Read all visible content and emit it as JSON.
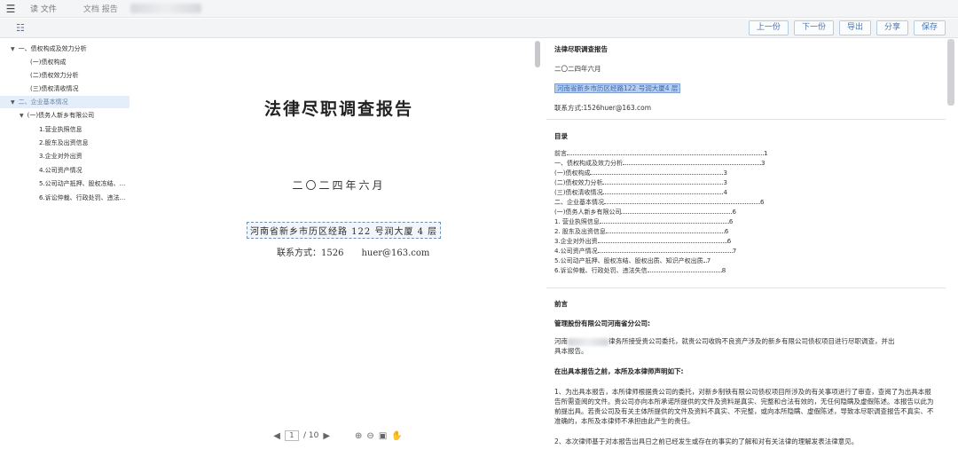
{
  "titlebar": {
    "tab1": "读 文件",
    "tab2": "文档 报告"
  },
  "toolbar": {
    "buttons": [
      "上一份",
      "下一份",
      "导出",
      "分享",
      "保存"
    ]
  },
  "sidebar": {
    "items": [
      "一、债权构成及效力分析",
      "(一)债权构成",
      "(二)债权效力分析",
      "(三)债权清收情况",
      "二、企业基本情况",
      "(一)债务人新乡有限公司",
      "1.营业执照信息",
      "2.股东及出资信息",
      "3.企业对外出资",
      "4.公司资产情况",
      "5.公司动产抵押、股权冻结、...",
      "6.诉讼仲裁、行政处罚、违法..."
    ]
  },
  "document": {
    "title": "法律尽职调查报告",
    "date": "二〇二四年六月",
    "address": "河南省新乡市历区经路 122 号润大厦 4 层",
    "contact": "联系方式：1526　　huer@163.com"
  },
  "pager": {
    "current_page": "1",
    "total": "/ 10"
  },
  "right_panel": {
    "title": "法律尽职调查报告",
    "date": "二〇二四年六月",
    "address": "河南省新乡市历区经路122 号润大厦4 层",
    "contact": "联系方式:1526huer@163.com",
    "toc_title": "目录",
    "toc": [
      {
        "label": "前言",
        "page": "1"
      },
      {
        "label": "一、债权构成及效力分析",
        "page": "3"
      },
      {
        "label": "(一)债权构成",
        "page": "3"
      },
      {
        "label": "(二)债权效力分析",
        "page": "3"
      },
      {
        "label": "(三)债权清收情况",
        "page": "4"
      },
      {
        "label": "二、企业基本情况",
        "page": "6"
      },
      {
        "label": "(一)债务人新乡有限公司",
        "page": "6"
      },
      {
        "label": "1. 营业执照信息",
        "page": "6"
      },
      {
        "label": "2. 股东及出资信息",
        "page": "6"
      },
      {
        "label": "3.企业对外出资",
        "page": "6"
      },
      {
        "label": "4.公司资产情况",
        "page": "7"
      },
      {
        "label": "5.公司动产抵押、股权冻结、股权出质、知识产权出质",
        "page": "7"
      },
      {
        "label": "6.诉讼仲裁、行政处罚、违法失信",
        "page": "8"
      }
    ],
    "preface_title": "前言",
    "addressee": "管理股份有限公司河南省分公司:",
    "intro_line1_pre": "河南",
    "intro_line1_post": "律务所接受贵公司委托，就贵公司收购不良资产涉及的新乡有限公司债权项目进行尽职调查，并出",
    "intro_line2": "具本报告。",
    "statement_title": "在出具本报告之前，本所及本律师声明如下:",
    "para1": "1、为出具本报告，本所律师根据贵公司的委托，对新乡制铁有限公司债权项目所涉及的有关事项进行了审查，查阅了为出具本报告所需查阅的文件。贵公司亦向本所承诺所提供的文件及资料是真实、完整和合法有效的，无任何隐瞒及虚假陈述。本报告以此为前提出具。若贵公司及有关主体所提供的文件及资料不真实、不完整，或向本所隐瞒、虚假陈述，导致本尽职调查报告不真实、不准确的，本所及本律师不承担由此产生的责任。",
    "para2": "2、本次律师基于对本报告出具日之前已经发生或存在的事实的了解和对有关法律的理解发表法律意见。"
  }
}
